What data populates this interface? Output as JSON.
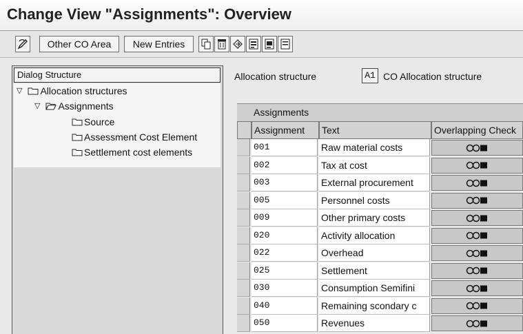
{
  "window": {
    "title": "Change View \"Assignments\": Overview"
  },
  "toolbar": {
    "buttons": [
      {
        "label": "Other CO Area"
      },
      {
        "label": "New Entries"
      }
    ],
    "icons": [
      "display-change-icon",
      "copy-icon",
      "delete-icon",
      "undo-icon",
      "select-all-icon",
      "select-block-icon",
      "deselect-all-icon"
    ]
  },
  "dialog_structure": {
    "header": "Dialog Structure",
    "items": [
      {
        "label": "Allocation structures",
        "level": 0,
        "expanded": true
      },
      {
        "label": "Assignments",
        "level": 1,
        "expanded": true,
        "open_folder": true
      },
      {
        "label": "Source",
        "level": 2
      },
      {
        "label": "Assessment Cost Element",
        "level": 2
      },
      {
        "label": "Settlement cost elements",
        "level": 2
      }
    ]
  },
  "allocation": {
    "label": "Allocation structure",
    "code": "A1",
    "description": "CO Allocation structure"
  },
  "table": {
    "title": "Assignments",
    "columns": [
      "Assignment",
      "Text",
      "Overlapping Check"
    ],
    "rows": [
      {
        "assignment": "001",
        "text": "Raw material costs"
      },
      {
        "assignment": "002",
        "text": "Tax at cost"
      },
      {
        "assignment": "003",
        "text": "External procurement"
      },
      {
        "assignment": "005",
        "text": "Personnel costs"
      },
      {
        "assignment": "009",
        "text": "Other primary costs"
      },
      {
        "assignment": "020",
        "text": "Activity allocation"
      },
      {
        "assignment": "022",
        "text": "Overhead"
      },
      {
        "assignment": "025",
        "text": "Settlement"
      },
      {
        "assignment": "030",
        "text": "Consumption Semifini"
      },
      {
        "assignment": "040",
        "text": "Remaining scondary c"
      },
      {
        "assignment": "050",
        "text": "Revenues"
      }
    ]
  }
}
